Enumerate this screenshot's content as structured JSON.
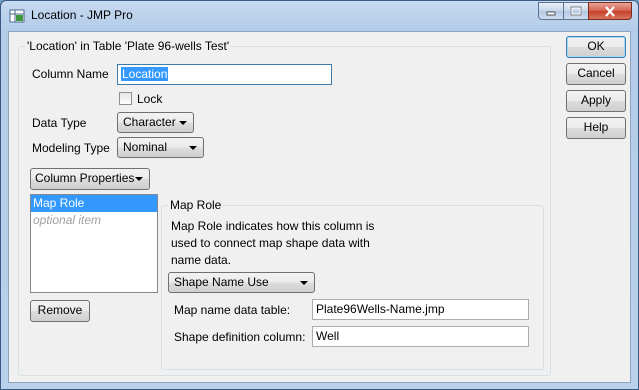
{
  "window": {
    "title": "Location - JMP Pro",
    "app_icon": "jmp-app-icon"
  },
  "group": {
    "title": "'Location' in Table 'Plate 96-wells Test'"
  },
  "fields": {
    "column_name_label": "Column Name",
    "column_name_value": "Location",
    "lock_label": "Lock",
    "lock_checked": false,
    "data_type_label": "Data Type",
    "data_type_value": "Character",
    "modeling_type_label": "Modeling Type",
    "modeling_type_value": "Nominal"
  },
  "column_properties": {
    "menu_label": "Column Properties",
    "items": [
      "Map Role",
      "optional item"
    ],
    "selected_index": 0,
    "remove_label": "Remove"
  },
  "map_role": {
    "title": "Map Role",
    "description_line1": "Map Role indicates how this column is",
    "description_line2": "used to connect map shape data with",
    "description_line3": "name data.",
    "use_value": "Shape Name Use",
    "table_label": "Map name data table:",
    "table_value": "Plate96Wells-Name.jmp",
    "column_label": "Shape definition column:",
    "column_value": "Well"
  },
  "actions": {
    "ok": "OK",
    "cancel": "Cancel",
    "apply": "Apply",
    "help": "Help"
  },
  "colors": {
    "selection": "#3399ff",
    "title_bar": "#b9d1ea",
    "close_button": "#c7402a"
  }
}
